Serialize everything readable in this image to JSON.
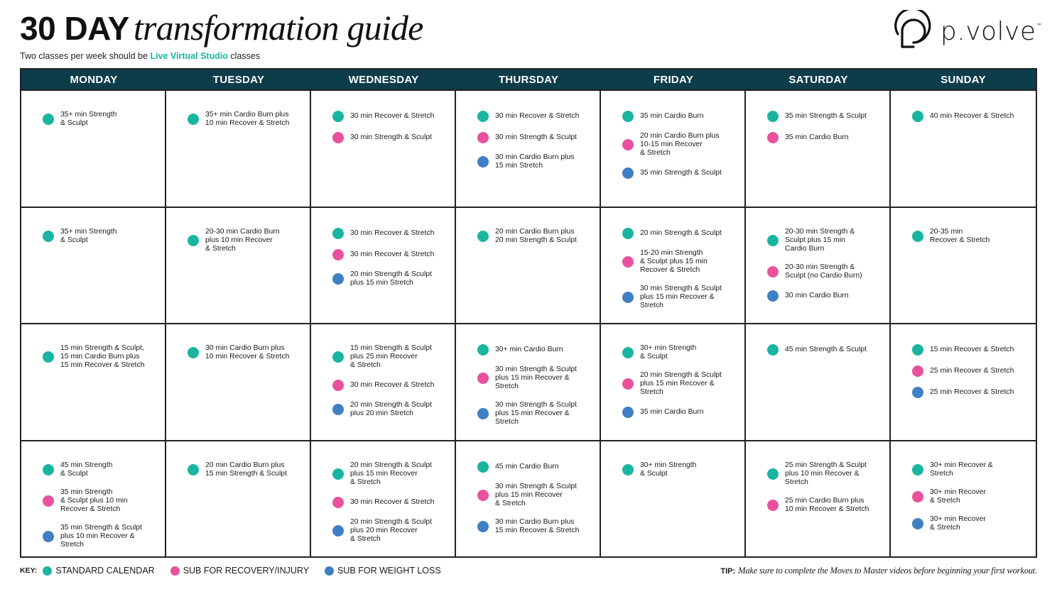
{
  "header": {
    "title_bold": "30 DAY",
    "title_italic": "transformation guide",
    "subtitle_prefix": "Two classes per week should be ",
    "subtitle_highlight": "Live Virtual Studio",
    "subtitle_suffix": " classes",
    "logo_text": "p.volve",
    "logo_tm": "™"
  },
  "colors": {
    "standard": "#1ab5a0",
    "recovery": "#e8519e",
    "weight_loss": "#3f7fc4",
    "header_bg": "#0d3c4b"
  },
  "days": [
    "MONDAY",
    "TUESDAY",
    "WEDNESDAY",
    "THURSDAY",
    "FRIDAY",
    "SATURDAY",
    "SUNDAY"
  ],
  "weeks": [
    [
      [
        {
          "type": "standard",
          "text": "35+ min Strength\n& Sculpt"
        }
      ],
      [
        {
          "type": "standard",
          "text": "35+ min Cardio Burn plus\n10 min Recover & Stretch"
        }
      ],
      [
        {
          "type": "standard",
          "text": "30 min Recover & Stretch"
        },
        {
          "type": "recovery",
          "text": "30 min Strength & Sculpt"
        }
      ],
      [
        {
          "type": "standard",
          "text": "30 min Recover & Stretch"
        },
        {
          "type": "recovery",
          "text": "30 min Strength & Sculpt"
        },
        {
          "type": "weight_loss",
          "text": "30 min Cardio Burn plus\n15 min Stretch"
        }
      ],
      [
        {
          "type": "standard",
          "text": "35 min Cardio Burn"
        },
        {
          "type": "recovery",
          "text": "20 min Cardio Burn plus\n10-15 min Recover\n& Stretch"
        },
        {
          "type": "weight_loss",
          "text": "35 min Strength & Sculpt"
        }
      ],
      [
        {
          "type": "standard",
          "text": "35 min Strength & Sculpt"
        },
        {
          "type": "recovery",
          "text": "35 min Cardio Burn"
        }
      ],
      [
        {
          "type": "standard",
          "text": "40 min Recover & Stretch"
        }
      ]
    ],
    [
      [
        {
          "type": "standard",
          "text": "35+ min Strength\n& Sculpt"
        }
      ],
      [
        {
          "type": "standard",
          "text": "20-30 min Cardio Burn\nplus 10 min Recover\n& Stretch"
        }
      ],
      [
        {
          "type": "standard",
          "text": "30 min Recover & Stretch"
        },
        {
          "type": "recovery",
          "text": "30 min Recover & Stretch"
        },
        {
          "type": "weight_loss",
          "text": "20 min Strength & Sculpt\nplus 15 min Stretch"
        }
      ],
      [
        {
          "type": "standard",
          "text": "20 min Cardio Burn plus\n20 min Strength & Sculpt"
        }
      ],
      [
        {
          "type": "standard",
          "text": "20 min Strength & Sculpt"
        },
        {
          "type": "recovery",
          "text": "15-20 min Strength\n& Sculpt plus 15 min\nRecover & Stretch"
        },
        {
          "type": "weight_loss",
          "text": "30 min Strength & Sculpt\nplus 15 min Recover &\nStretch"
        }
      ],
      [
        {
          "type": "standard",
          "text": "20-30 min Strength &\nSculpt plus 15 min\nCardio Burn"
        },
        {
          "type": "recovery",
          "text": "20-30 min Strength &\nSculpt (no Cardio Burn)"
        },
        {
          "type": "weight_loss",
          "text": "30 min Cardio Burn"
        }
      ],
      [
        {
          "type": "standard",
          "text": "20-35 min\nRecover & Stretch"
        }
      ]
    ],
    [
      [
        {
          "type": "standard",
          "text": "15 min Strength & Sculpt,\n15 min Cardio Burn plus\n15 min Recover & Stretch"
        }
      ],
      [
        {
          "type": "standard",
          "text": "30 min Cardio Burn plus\n10 min Recover & Stretch"
        }
      ],
      [
        {
          "type": "standard",
          "text": "15 min Strength & Sculpt\nplus 25 min Recover\n& Stretch"
        },
        {
          "type": "recovery",
          "text": "30 min Recover & Stretch"
        },
        {
          "type": "weight_loss",
          "text": "20 min Strength & Sculpt\nplus 20 min Stretch"
        }
      ],
      [
        {
          "type": "standard",
          "text": "30+ min Cardio Burn"
        },
        {
          "type": "recovery",
          "text": "30 min Strength & Sculpt\nplus 15 min Recover &\nStretch"
        },
        {
          "type": "weight_loss",
          "text": "30 min Strength & Sculpt\nplus 15 min Recover &\nStretch"
        }
      ],
      [
        {
          "type": "standard",
          "text": "30+ min Strength\n& Sculpt"
        },
        {
          "type": "recovery",
          "text": "20 min Strength & Sculpt\nplus 15 min Recover &\nStretch"
        },
        {
          "type": "weight_loss",
          "text": "35 min Cardio Burn"
        }
      ],
      [
        {
          "type": "standard",
          "text": "45 min Strength & Sculpt"
        }
      ],
      [
        {
          "type": "standard",
          "text": "15 min Recover & Stretch"
        },
        {
          "type": "recovery",
          "text": "25 min Recover & Stretch"
        },
        {
          "type": "weight_loss",
          "text": "25 min Recover & Stretch"
        }
      ]
    ],
    [
      [
        {
          "type": "standard",
          "text": "45 min Strength\n& Sculpt"
        },
        {
          "type": "recovery",
          "text": "35 min Strength\n& Sculpt plus 10 min\nRecover & Stretch"
        },
        {
          "type": "weight_loss",
          "text": "35 min Strength & Sculpt\nplus 10 min Recover &\nStretch"
        }
      ],
      [
        {
          "type": "standard",
          "text": "20 min Cardio Burn plus\n15 min Strength & Sculpt"
        }
      ],
      [
        {
          "type": "standard",
          "text": "20 min Strength & Sculpt\nplus 15 min Recover\n& Stretch"
        },
        {
          "type": "recovery",
          "text": "30 min Recover & Stretch"
        },
        {
          "type": "weight_loss",
          "text": "20 min Strength & Sculpt\nplus 20 min Recover\n& Stretch"
        }
      ],
      [
        {
          "type": "standard",
          "text": "45 min Cardio Burn"
        },
        {
          "type": "recovery",
          "text": "30 min Strength & Sculpt\nplus 15 min Recover\n& Stretch"
        },
        {
          "type": "weight_loss",
          "text": "30 min Cardio Burn plus\n15 min Recover & Stretch"
        }
      ],
      [
        {
          "type": "standard",
          "text": "30+ min Strength\n& Sculpt"
        }
      ],
      [
        {
          "type": "standard",
          "text": "25 min Strength & Sculpt\nplus 10 min Recover &\nStretch"
        },
        {
          "type": "recovery",
          "text": "25 min Cardio Burn plus\n10 min Recover & Stretch"
        }
      ],
      [
        {
          "type": "standard",
          "text": "30+ min Recover &\nStretch"
        },
        {
          "type": "recovery",
          "text": "30+ min Recover\n& Stretch"
        },
        {
          "type": "weight_loss",
          "text": "30+ min Recover\n& Stretch"
        }
      ]
    ]
  ],
  "key": {
    "label": "KEY:",
    "items": [
      {
        "type": "standard",
        "label": "STANDARD CALENDAR"
      },
      {
        "type": "recovery",
        "label": "SUB FOR RECOVERY/INJURY"
      },
      {
        "type": "weight_loss",
        "label": "SUB FOR WEIGHT LOSS"
      }
    ]
  },
  "tip": {
    "label": "TIP:",
    "text": "Make sure to complete the Moves to Master videos before beginning your first workout."
  }
}
